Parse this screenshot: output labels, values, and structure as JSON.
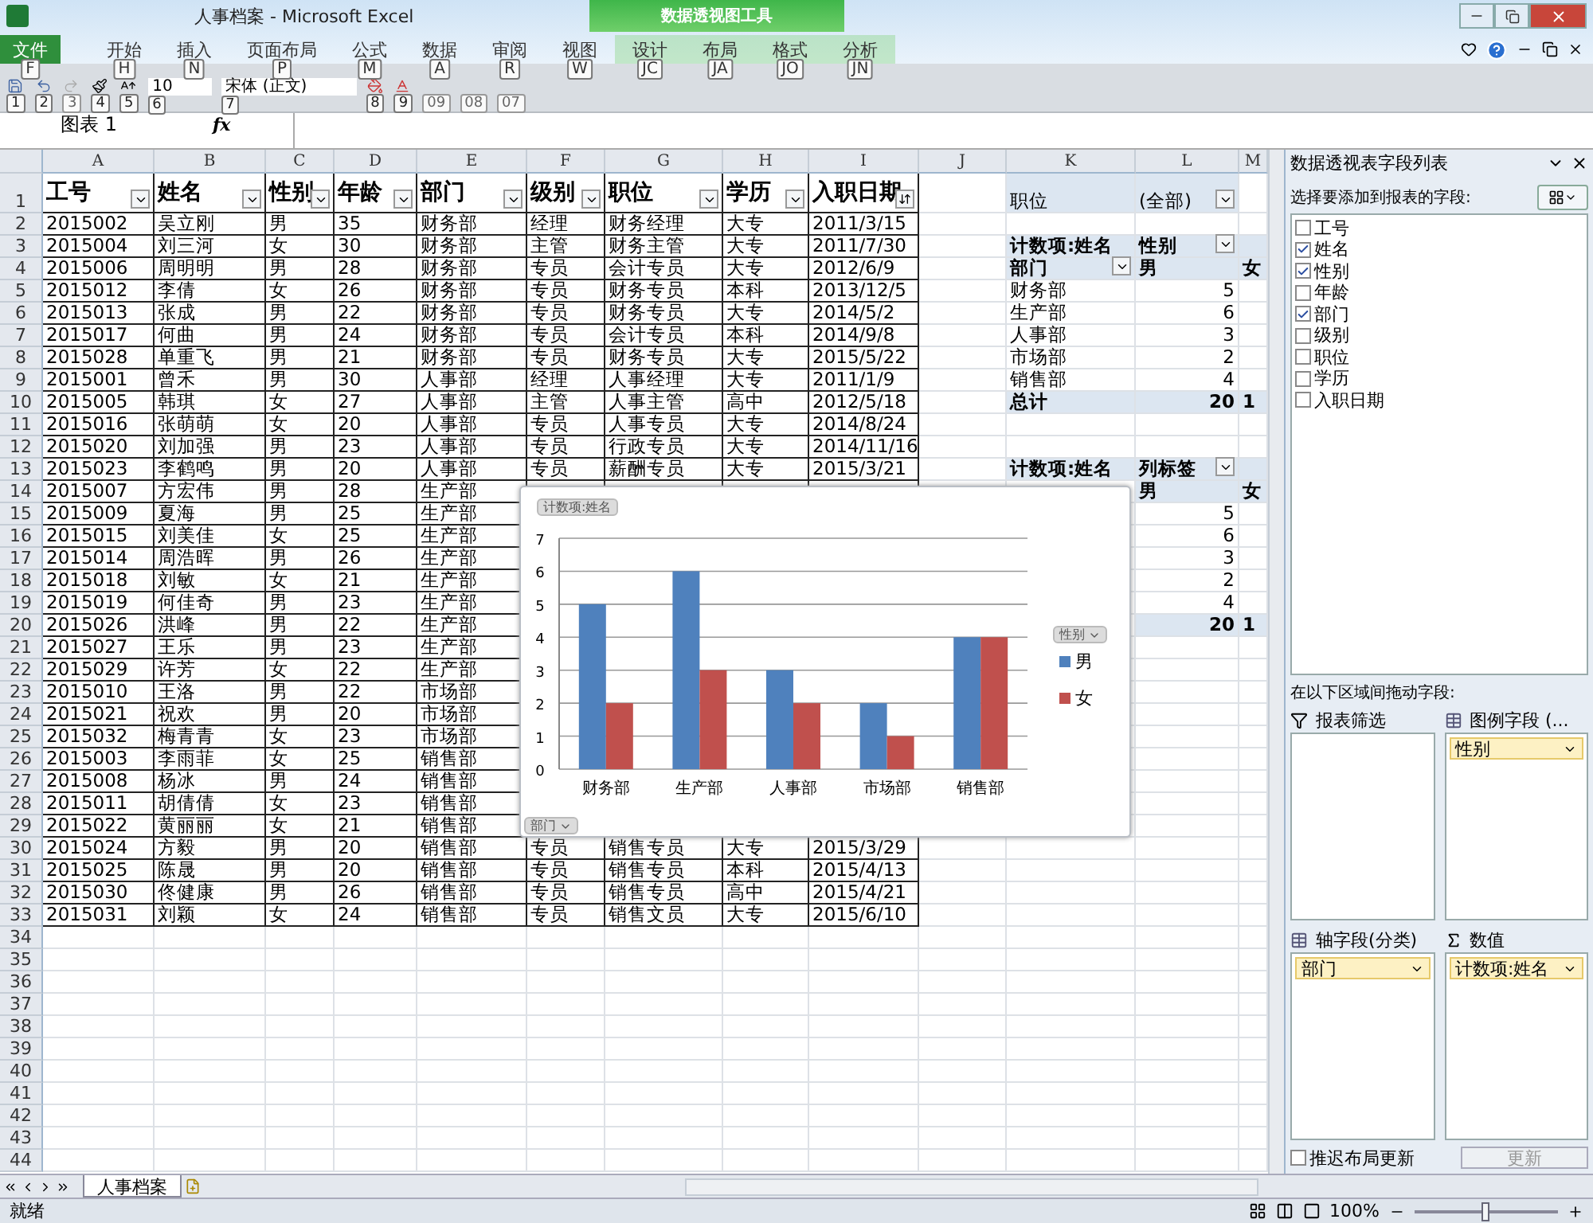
{
  "window": {
    "title": "人事档案 - Microsoft Excel",
    "context_group": "数据透视图工具"
  },
  "ribbon_tabs": [
    {
      "label": "文件",
      "keytip": "F",
      "kind": "file"
    },
    {
      "label": "开始",
      "keytip": "H",
      "kind": "tab"
    },
    {
      "label": "插入",
      "keytip": "N",
      "kind": "tab"
    },
    {
      "label": "页面布局",
      "keytip": "P",
      "kind": "tab"
    },
    {
      "label": "公式",
      "keytip": "M",
      "kind": "tab"
    },
    {
      "label": "数据",
      "keytip": "A",
      "kind": "tab"
    },
    {
      "label": "审阅",
      "keytip": "R",
      "kind": "tab"
    },
    {
      "label": "视图",
      "keytip": "W",
      "kind": "tab"
    },
    {
      "label": "设计",
      "keytip": "JC",
      "kind": "context"
    },
    {
      "label": "布局",
      "keytip": "JA",
      "kind": "context"
    },
    {
      "label": "格式",
      "keytip": "JO",
      "kind": "context"
    },
    {
      "label": "分析",
      "keytip": "JN",
      "kind": "context"
    }
  ],
  "quick_toolbar": [
    {
      "kind": "save",
      "keytip": "1",
      "disabled": false
    },
    {
      "kind": "undo",
      "keytip": "2",
      "disabled": false
    },
    {
      "kind": "redo",
      "keytip": "3",
      "disabled": true
    },
    {
      "kind": "brush",
      "keytip": "4",
      "disabled": false
    },
    {
      "kind": "grow",
      "keytip": "5",
      "disabled": false
    },
    {
      "kind": "size",
      "value": "10",
      "keytip": "6",
      "disabled": false
    },
    {
      "kind": "font",
      "value": "宋体 (正文)",
      "keytip": "7",
      "disabled": false
    },
    {
      "kind": "fill",
      "keytip": "8",
      "disabled": false
    },
    {
      "kind": "color",
      "keytip": "9",
      "disabled": false
    },
    {
      "kind": "more",
      "keytip": "09",
      "disabled": true
    },
    {
      "kind": "more",
      "keytip": "08",
      "disabled": true
    },
    {
      "kind": "more",
      "keytip": "07",
      "disabled": true
    }
  ],
  "formula_bar": {
    "name_box": "图表 1",
    "fx": "fx"
  },
  "sheet": {
    "columns": [
      "A",
      "B",
      "C",
      "D",
      "E",
      "F",
      "G",
      "H",
      "I",
      "J",
      "K",
      "L",
      "M"
    ],
    "header_row": {
      "number": "1",
      "cells": [
        {
          "text": "工号",
          "kind": "filter"
        },
        {
          "text": "姓名",
          "kind": "filter"
        },
        {
          "text": "性别",
          "kind": "filter"
        },
        {
          "text": "年龄",
          "kind": "filter"
        },
        {
          "text": "部门",
          "kind": "filter"
        },
        {
          "text": "级别",
          "kind": "filter"
        },
        {
          "text": "职位",
          "kind": "filter"
        },
        {
          "text": "学历",
          "kind": "filter"
        },
        {
          "text": "入职日期",
          "kind": "sort"
        }
      ]
    },
    "rows": [
      {
        "number": "2",
        "cells": [
          "2015002",
          "吴立刚",
          "男",
          "35",
          "财务部",
          "经理",
          "财务经理",
          "大专",
          "2011/3/15"
        ]
      },
      {
        "number": "3",
        "cells": [
          "2015004",
          "刘三河",
          "女",
          "30",
          "财务部",
          "主管",
          "财务主管",
          "大专",
          "2011/7/30"
        ]
      },
      {
        "number": "4",
        "cells": [
          "2015006",
          "周明明",
          "男",
          "28",
          "财务部",
          "专员",
          "会计专员",
          "大专",
          "2012/6/9"
        ]
      },
      {
        "number": "5",
        "cells": [
          "2015012",
          "李倩",
          "女",
          "26",
          "财务部",
          "专员",
          "财务专员",
          "本科",
          "2013/12/5"
        ]
      },
      {
        "number": "6",
        "cells": [
          "2015013",
          "张成",
          "男",
          "22",
          "财务部",
          "专员",
          "财务专员",
          "大专",
          "2014/5/2"
        ]
      },
      {
        "number": "7",
        "cells": [
          "2015017",
          "何曲",
          "男",
          "24",
          "财务部",
          "专员",
          "会计专员",
          "本科",
          "2014/9/8"
        ]
      },
      {
        "number": "8",
        "cells": [
          "2015028",
          "单重飞",
          "男",
          "21",
          "财务部",
          "专员",
          "财务专员",
          "大专",
          "2015/5/22"
        ]
      },
      {
        "number": "9",
        "cells": [
          "2015001",
          "曾禾",
          "男",
          "30",
          "人事部",
          "经理",
          "人事经理",
          "大专",
          "2011/1/9"
        ]
      },
      {
        "number": "10",
        "cells": [
          "2015005",
          "韩琪",
          "女",
          "27",
          "人事部",
          "主管",
          "人事主管",
          "高中",
          "2012/5/18"
        ]
      },
      {
        "number": "11",
        "cells": [
          "2015016",
          "张萌萌",
          "女",
          "20",
          "人事部",
          "专员",
          "人事专员",
          "大专",
          "2014/8/24"
        ]
      },
      {
        "number": "12",
        "cells": [
          "2015020",
          "刘加强",
          "男",
          "23",
          "人事部",
          "专员",
          "行政专员",
          "大专",
          "2014/11/16"
        ]
      },
      {
        "number": "13",
        "cells": [
          "2015023",
          "李鹤鸣",
          "男",
          "20",
          "人事部",
          "专员",
          "薪酬专员",
          "大专",
          "2015/3/21"
        ]
      },
      {
        "number": "14",
        "cells": [
          "2015007",
          "方宏伟",
          "男",
          "28",
          "生产部"
        ]
      },
      {
        "number": "15",
        "cells": [
          "2015009",
          "夏海",
          "男",
          "25",
          "生产部"
        ]
      },
      {
        "number": "16",
        "cells": [
          "2015015",
          "刘美佳",
          "女",
          "25",
          "生产部"
        ]
      },
      {
        "number": "17",
        "cells": [
          "2015014",
          "周浩晖",
          "男",
          "26",
          "生产部"
        ]
      },
      {
        "number": "18",
        "cells": [
          "2015018",
          "刘敏",
          "女",
          "21",
          "生产部"
        ]
      },
      {
        "number": "19",
        "cells": [
          "2015019",
          "何佳奇",
          "男",
          "23",
          "生产部"
        ]
      },
      {
        "number": "20",
        "cells": [
          "2015026",
          "洪峰",
          "男",
          "22",
          "生产部"
        ]
      },
      {
        "number": "21",
        "cells": [
          "2015027",
          "王乐",
          "男",
          "23",
          "生产部"
        ]
      },
      {
        "number": "22",
        "cells": [
          "2015029",
          "许芳",
          "女",
          "22",
          "生产部"
        ]
      },
      {
        "number": "23",
        "cells": [
          "2015010",
          "王洛",
          "男",
          "22",
          "市场部"
        ]
      },
      {
        "number": "24",
        "cells": [
          "2015021",
          "祝欢",
          "男",
          "20",
          "市场部"
        ]
      },
      {
        "number": "25",
        "cells": [
          "2015032",
          "梅青青",
          "女",
          "23",
          "市场部"
        ]
      },
      {
        "number": "26",
        "cells": [
          "2015003",
          "李雨菲",
          "女",
          "25",
          "销售部"
        ]
      },
      {
        "number": "27",
        "cells": [
          "2015008",
          "杨冰",
          "男",
          "24",
          "销售部"
        ]
      },
      {
        "number": "28",
        "cells": [
          "2015011",
          "胡倩倩",
          "女",
          "23",
          "销售部"
        ]
      },
      {
        "number": "29",
        "cells": [
          "2015022",
          "黄丽丽",
          "女",
          "21",
          "销售部"
        ]
      },
      {
        "number": "30",
        "cells": [
          "2015024",
          "方毅",
          "男",
          "20",
          "销售部",
          "专员",
          "销售专员",
          "大专",
          "2015/3/29"
        ]
      },
      {
        "number": "31",
        "cells": [
          "2015025",
          "陈晟",
          "男",
          "20",
          "销售部",
          "专员",
          "销售专员",
          "本科",
          "2015/4/13"
        ]
      },
      {
        "number": "32",
        "cells": [
          "2015030",
          "佟健康",
          "男",
          "26",
          "销售部",
          "专员",
          "销售专员",
          "高中",
          "2015/4/21"
        ]
      },
      {
        "number": "33",
        "cells": [
          "2015031",
          "刘颖",
          "女",
          "24",
          "销售部",
          "专员",
          "销售文员",
          "大专",
          "2015/6/10"
        ]
      }
    ],
    "empty_rows": [
      "34",
      "35",
      "36",
      "37",
      "38",
      "39",
      "40",
      "41",
      "42",
      "43",
      "44"
    ]
  },
  "pivot_tables": [
    {
      "filter_label": "职位",
      "filter_value": "(全部)",
      "value_label": "计数项:姓名",
      "col_field": "性别",
      "row_field": "部门",
      "col_items": [
        "男",
        "女"
      ],
      "rows": [
        {
          "label": "财务部",
          "value": "5"
        },
        {
          "label": "生产部",
          "value": "6"
        },
        {
          "label": "人事部",
          "value": "3"
        },
        {
          "label": "市场部",
          "value": "2"
        },
        {
          "label": "销售部",
          "value": "4"
        }
      ],
      "total_label": "总计",
      "total": [
        "20",
        "1"
      ]
    },
    {
      "value_label": "计数项:姓名",
      "col_field": "列标签",
      "col_items": [
        "男",
        "女"
      ],
      "values": [
        "5",
        "6",
        "3",
        "2",
        "4"
      ],
      "total": [
        "20",
        "1"
      ]
    }
  ],
  "pivot_chart": {
    "value_button": "计数项:姓名",
    "axis_button": "部门",
    "legend_button": "性别",
    "chart_data": {
      "type": "bar",
      "categories": [
        "财务部",
        "生产部",
        "人事部",
        "市场部",
        "销售部"
      ],
      "series": [
        {
          "name": "男",
          "color": "#4f81bd",
          "values": [
            5,
            6,
            3,
            2,
            4
          ]
        },
        {
          "name": "女",
          "color": "#c0504d",
          "values": [
            2,
            3,
            2,
            1,
            4
          ]
        }
      ],
      "ylim": [
        0,
        7
      ],
      "yticks": [
        0,
        1,
        2,
        3,
        4,
        5,
        6,
        7
      ],
      "grid": true
    }
  },
  "field_list": {
    "title": "数据透视表字段列表",
    "choose_label": "选择要添加到报表的字段:",
    "fields": [
      {
        "label": "工号",
        "checked": false
      },
      {
        "label": "姓名",
        "checked": true
      },
      {
        "label": "性别",
        "checked": true
      },
      {
        "label": "年龄",
        "checked": false
      },
      {
        "label": "部门",
        "checked": true
      },
      {
        "label": "级别",
        "checked": false
      },
      {
        "label": "职位",
        "checked": false
      },
      {
        "label": "学历",
        "checked": false
      },
      {
        "label": "入职日期",
        "checked": false
      }
    ],
    "drag_label": "在以下区域间拖动字段:",
    "areas": [
      {
        "kind": "filter",
        "title": "报表筛选"
      },
      {
        "kind": "legend",
        "title": "图例字段 (...",
        "items": [
          "性别"
        ]
      },
      {
        "kind": "axis",
        "title": "轴字段(分类)",
        "items": [
          "部门"
        ]
      },
      {
        "kind": "values",
        "title": "数值",
        "items": [
          "计数项:姓名"
        ]
      }
    ],
    "defer": {
      "label": "推迟布局更新",
      "checked": false
    },
    "update_button": {
      "label": "更新",
      "disabled": true
    }
  },
  "sheet_tabs": [
    {
      "label": "人事档案",
      "selected": true
    }
  ],
  "status_bar": {
    "status": "就绪",
    "zoom": "100%",
    "level": 0.5
  }
}
